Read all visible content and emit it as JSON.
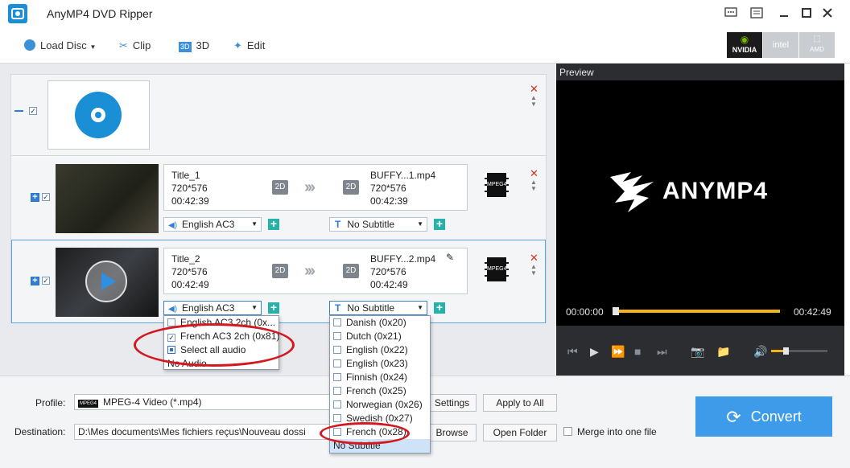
{
  "app": {
    "title": "AnyMP4 DVD Ripper"
  },
  "toolbar": {
    "load_disc": "Load Disc",
    "clip": "Clip",
    "threed": "3D",
    "edit": "Edit"
  },
  "gpu": {
    "nvidia": "NVIDIA",
    "intel": "intel",
    "amd": "AMD"
  },
  "titles": [
    {
      "name": "Title_1",
      "resolution": "720*576",
      "duration": "00:42:39",
      "badge_in": "2D",
      "badge_out": "2D",
      "output_name": "BUFFY...1.mp4",
      "output_resolution": "720*576",
      "output_duration": "00:42:39",
      "audio": "English AC3",
      "subtitle": "No Subtitle",
      "format_icon": "MPEG4"
    },
    {
      "name": "Title_2",
      "resolution": "720*576",
      "duration": "00:42:49",
      "badge_in": "2D",
      "badge_out": "2D",
      "output_name": "BUFFY...2.mp4",
      "output_resolution": "720*576",
      "output_duration": "00:42:49",
      "audio": "English AC3",
      "subtitle": "No Subtitle",
      "format_icon": "MPEG4"
    }
  ],
  "audio_popup": {
    "items": [
      {
        "label": "English AC3 2ch (0x...",
        "checked": false
      },
      {
        "label": "French AC3 2ch (0x81)",
        "checked": true
      },
      {
        "label": "Select all audio",
        "checked": "partial"
      },
      {
        "label": "No Audio",
        "checked": null
      }
    ]
  },
  "subtitle_popup": {
    "items": [
      "Danish (0x20)",
      "Dutch (0x21)",
      "English (0x22)",
      "English (0x23)",
      "Finnish (0x24)",
      "French (0x25)",
      "Norwegian (0x26)",
      "Swedish (0x27)",
      "French (0x28)"
    ],
    "none": "No Subtitle"
  },
  "bottom": {
    "profile_label": "Profile:",
    "profile_value": "MPEG-4 Video (*.mp4)",
    "profile_icon": "MPEG4",
    "settings": "Settings",
    "apply_all": "Apply to All",
    "destination_label": "Destination:",
    "destination_value": "D:\\Mes documents\\Mes fichiers reçus\\Nouveau dossi",
    "browse": "Browse",
    "open_folder": "Open Folder",
    "merge": "Merge into one file",
    "convert": "Convert"
  },
  "preview": {
    "label": "Preview",
    "brand": "ANYMP4",
    "time_start": "00:00:00",
    "time_end": "00:42:49"
  },
  "colors": {
    "accent": "#3d9be9",
    "annotation": "#d4181f",
    "timeline": "#f2b31a"
  }
}
